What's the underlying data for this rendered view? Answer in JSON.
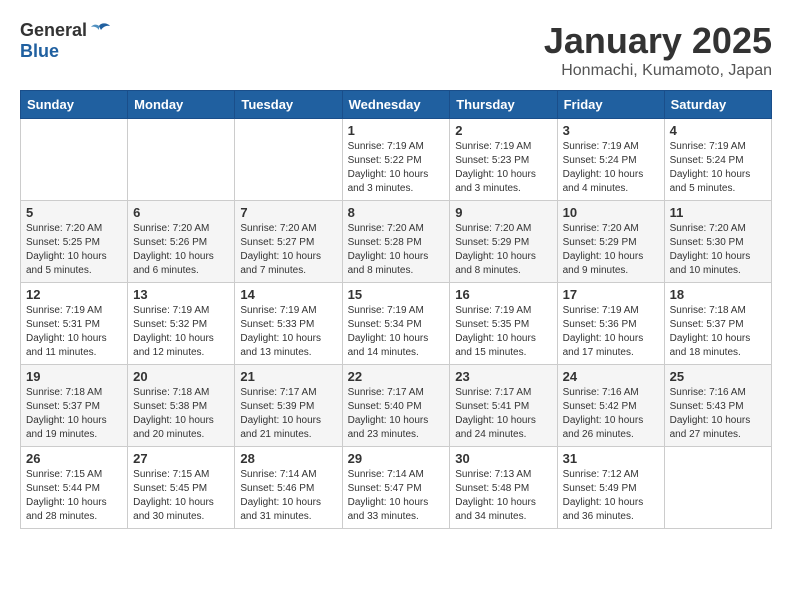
{
  "header": {
    "logo_general": "General",
    "logo_blue": "Blue",
    "month": "January 2025",
    "location": "Honmachi, Kumamoto, Japan"
  },
  "weekdays": [
    "Sunday",
    "Monday",
    "Tuesday",
    "Wednesday",
    "Thursday",
    "Friday",
    "Saturday"
  ],
  "weeks": [
    [
      {
        "day": "",
        "info": ""
      },
      {
        "day": "",
        "info": ""
      },
      {
        "day": "",
        "info": ""
      },
      {
        "day": "1",
        "info": "Sunrise: 7:19 AM\nSunset: 5:22 PM\nDaylight: 10 hours\nand 3 minutes."
      },
      {
        "day": "2",
        "info": "Sunrise: 7:19 AM\nSunset: 5:23 PM\nDaylight: 10 hours\nand 3 minutes."
      },
      {
        "day": "3",
        "info": "Sunrise: 7:19 AM\nSunset: 5:24 PM\nDaylight: 10 hours\nand 4 minutes."
      },
      {
        "day": "4",
        "info": "Sunrise: 7:19 AM\nSunset: 5:24 PM\nDaylight: 10 hours\nand 5 minutes."
      }
    ],
    [
      {
        "day": "5",
        "info": "Sunrise: 7:20 AM\nSunset: 5:25 PM\nDaylight: 10 hours\nand 5 minutes."
      },
      {
        "day": "6",
        "info": "Sunrise: 7:20 AM\nSunset: 5:26 PM\nDaylight: 10 hours\nand 6 minutes."
      },
      {
        "day": "7",
        "info": "Sunrise: 7:20 AM\nSunset: 5:27 PM\nDaylight: 10 hours\nand 7 minutes."
      },
      {
        "day": "8",
        "info": "Sunrise: 7:20 AM\nSunset: 5:28 PM\nDaylight: 10 hours\nand 8 minutes."
      },
      {
        "day": "9",
        "info": "Sunrise: 7:20 AM\nSunset: 5:29 PM\nDaylight: 10 hours\nand 8 minutes."
      },
      {
        "day": "10",
        "info": "Sunrise: 7:20 AM\nSunset: 5:29 PM\nDaylight: 10 hours\nand 9 minutes."
      },
      {
        "day": "11",
        "info": "Sunrise: 7:20 AM\nSunset: 5:30 PM\nDaylight: 10 hours\nand 10 minutes."
      }
    ],
    [
      {
        "day": "12",
        "info": "Sunrise: 7:19 AM\nSunset: 5:31 PM\nDaylight: 10 hours\nand 11 minutes."
      },
      {
        "day": "13",
        "info": "Sunrise: 7:19 AM\nSunset: 5:32 PM\nDaylight: 10 hours\nand 12 minutes."
      },
      {
        "day": "14",
        "info": "Sunrise: 7:19 AM\nSunset: 5:33 PM\nDaylight: 10 hours\nand 13 minutes."
      },
      {
        "day": "15",
        "info": "Sunrise: 7:19 AM\nSunset: 5:34 PM\nDaylight: 10 hours\nand 14 minutes."
      },
      {
        "day": "16",
        "info": "Sunrise: 7:19 AM\nSunset: 5:35 PM\nDaylight: 10 hours\nand 15 minutes."
      },
      {
        "day": "17",
        "info": "Sunrise: 7:19 AM\nSunset: 5:36 PM\nDaylight: 10 hours\nand 17 minutes."
      },
      {
        "day": "18",
        "info": "Sunrise: 7:18 AM\nSunset: 5:37 PM\nDaylight: 10 hours\nand 18 minutes."
      }
    ],
    [
      {
        "day": "19",
        "info": "Sunrise: 7:18 AM\nSunset: 5:37 PM\nDaylight: 10 hours\nand 19 minutes."
      },
      {
        "day": "20",
        "info": "Sunrise: 7:18 AM\nSunset: 5:38 PM\nDaylight: 10 hours\nand 20 minutes."
      },
      {
        "day": "21",
        "info": "Sunrise: 7:17 AM\nSunset: 5:39 PM\nDaylight: 10 hours\nand 21 minutes."
      },
      {
        "day": "22",
        "info": "Sunrise: 7:17 AM\nSunset: 5:40 PM\nDaylight: 10 hours\nand 23 minutes."
      },
      {
        "day": "23",
        "info": "Sunrise: 7:17 AM\nSunset: 5:41 PM\nDaylight: 10 hours\nand 24 minutes."
      },
      {
        "day": "24",
        "info": "Sunrise: 7:16 AM\nSunset: 5:42 PM\nDaylight: 10 hours\nand 26 minutes."
      },
      {
        "day": "25",
        "info": "Sunrise: 7:16 AM\nSunset: 5:43 PM\nDaylight: 10 hours\nand 27 minutes."
      }
    ],
    [
      {
        "day": "26",
        "info": "Sunrise: 7:15 AM\nSunset: 5:44 PM\nDaylight: 10 hours\nand 28 minutes."
      },
      {
        "day": "27",
        "info": "Sunrise: 7:15 AM\nSunset: 5:45 PM\nDaylight: 10 hours\nand 30 minutes."
      },
      {
        "day": "28",
        "info": "Sunrise: 7:14 AM\nSunset: 5:46 PM\nDaylight: 10 hours\nand 31 minutes."
      },
      {
        "day": "29",
        "info": "Sunrise: 7:14 AM\nSunset: 5:47 PM\nDaylight: 10 hours\nand 33 minutes."
      },
      {
        "day": "30",
        "info": "Sunrise: 7:13 AM\nSunset: 5:48 PM\nDaylight: 10 hours\nand 34 minutes."
      },
      {
        "day": "31",
        "info": "Sunrise: 7:12 AM\nSunset: 5:49 PM\nDaylight: 10 hours\nand 36 minutes."
      },
      {
        "day": "",
        "info": ""
      }
    ]
  ]
}
